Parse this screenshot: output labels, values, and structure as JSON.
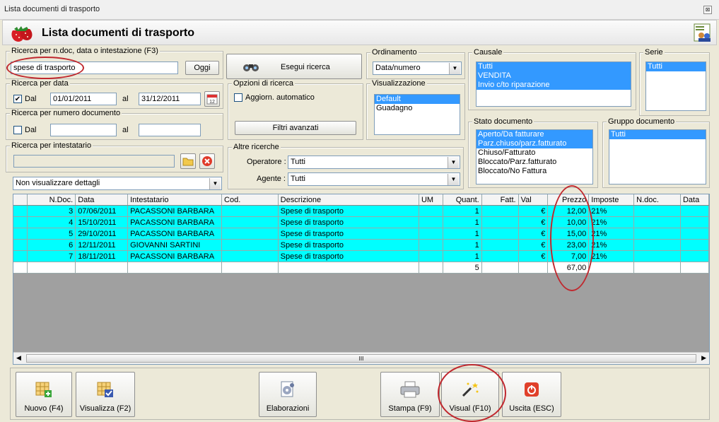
{
  "window": {
    "title": "Lista documenti di trasporto",
    "close_glyph": "⊠"
  },
  "header": {
    "title": "Lista documenti di trasporto"
  },
  "search_text": {
    "label": "Ricerca per n.doc, data o intestazione (F3)",
    "value": "spese di trasporto",
    "today_button": "Oggi"
  },
  "search_button": "Esegui ricerca",
  "date_search": {
    "label": "Ricerca per data",
    "from_label": "Dal",
    "from": "01/01/2011",
    "to_label": "al",
    "to": "31/12/2011"
  },
  "number_search": {
    "label": "Ricerca per numero documento",
    "from_label": "Dal",
    "to_label": "al"
  },
  "holder_search": {
    "label": "Ricerca per intestatario"
  },
  "detail_combo": "Non visualizzare dettagli",
  "search_options": {
    "label": "Opzioni di ricerca",
    "auto_update": "Aggiorn. automatico",
    "advanced_filters": "Filtri avanzati"
  },
  "ordering": {
    "label": "Ordinamento",
    "value": "Data/numero"
  },
  "view": {
    "label": "Visualizzazione",
    "items": [
      "Default",
      "Guadagno"
    ]
  },
  "causale": {
    "label": "Causale",
    "items": [
      "Tutti",
      "VENDITA",
      "Invio c/to riparazione"
    ]
  },
  "serie": {
    "label": "Serie",
    "items": [
      "Tutti"
    ]
  },
  "stato": {
    "label": "Stato documento",
    "items": [
      "Aperto/Da fatturare",
      "Parz.chiuso/parz.fatturato",
      "Chiuso/Fatturato",
      "Bloccato/Parz.fatturato",
      "Bloccato/No Fattura"
    ]
  },
  "gruppo": {
    "label": "Gruppo documento",
    "items": [
      "Tutti"
    ]
  },
  "other_searches": {
    "label": "Altre ricerche",
    "operator_label": "Operatore :",
    "operator_value": "Tutti",
    "agent_label": "Agente :",
    "agent_value": "Tutti"
  },
  "grid": {
    "columns": [
      "N.Doc.",
      "Data",
      "Intestatario",
      "Cod.",
      "Descrizione",
      "UM",
      "Quant.",
      "Fatt.",
      "Val",
      "Prezzo",
      "Imposte",
      "N.doc.",
      "Data"
    ],
    "rows": [
      {
        "ndoc": "3",
        "date": "07/06/2011",
        "holder": "PACASSONI BARBARA",
        "desc": "Spese di trasporto",
        "qty": "1",
        "val": "€",
        "price": "12,00",
        "tax": "21%"
      },
      {
        "ndoc": "4",
        "date": "15/10/2011",
        "holder": "PACASSONI BARBARA",
        "desc": "Spese di trasporto",
        "qty": "1",
        "val": "€",
        "price": "10,00",
        "tax": "21%"
      },
      {
        "ndoc": "5",
        "date": "29/10/2011",
        "holder": "PACASSONI BARBARA",
        "desc": "Spese di trasporto",
        "qty": "1",
        "val": "€",
        "price": "15,00",
        "tax": "21%"
      },
      {
        "ndoc": "6",
        "date": "12/11/2011",
        "holder": "GIOVANNI SARTINI",
        "desc": "Spese di trasporto",
        "qty": "1",
        "val": "€",
        "price": "23,00",
        "tax": "21%"
      },
      {
        "ndoc": "7",
        "date": "18/11/2011",
        "holder": "PACASSONI BARBARA",
        "desc": "Spese di trasporto",
        "qty": "1",
        "val": "€",
        "price": "7,00",
        "tax": "21%"
      }
    ],
    "total_qty": "5",
    "total_price": "67,00"
  },
  "toolbar": {
    "new": "Nuovo (F4)",
    "view": "Visualizza (F2)",
    "process": "Elaborazioni",
    "print": "Stampa (F9)",
    "visual": "Visual (F10)",
    "exit": "Uscita (ESC)"
  },
  "scrollbar": {
    "thumb_glyph": "III"
  },
  "colors": {
    "row_highlight": "#00ffff",
    "selection": "#3399ff",
    "annotation": "#c0282e"
  },
  "icons": [
    "strawberry-icon",
    "users-icon",
    "binoculars-icon",
    "calendar-icon",
    "folder-icon",
    "delete-icon",
    "new-doc-icon",
    "view-doc-icon",
    "gears-icon",
    "printer-icon",
    "magic-wand-icon",
    "power-icon"
  ]
}
